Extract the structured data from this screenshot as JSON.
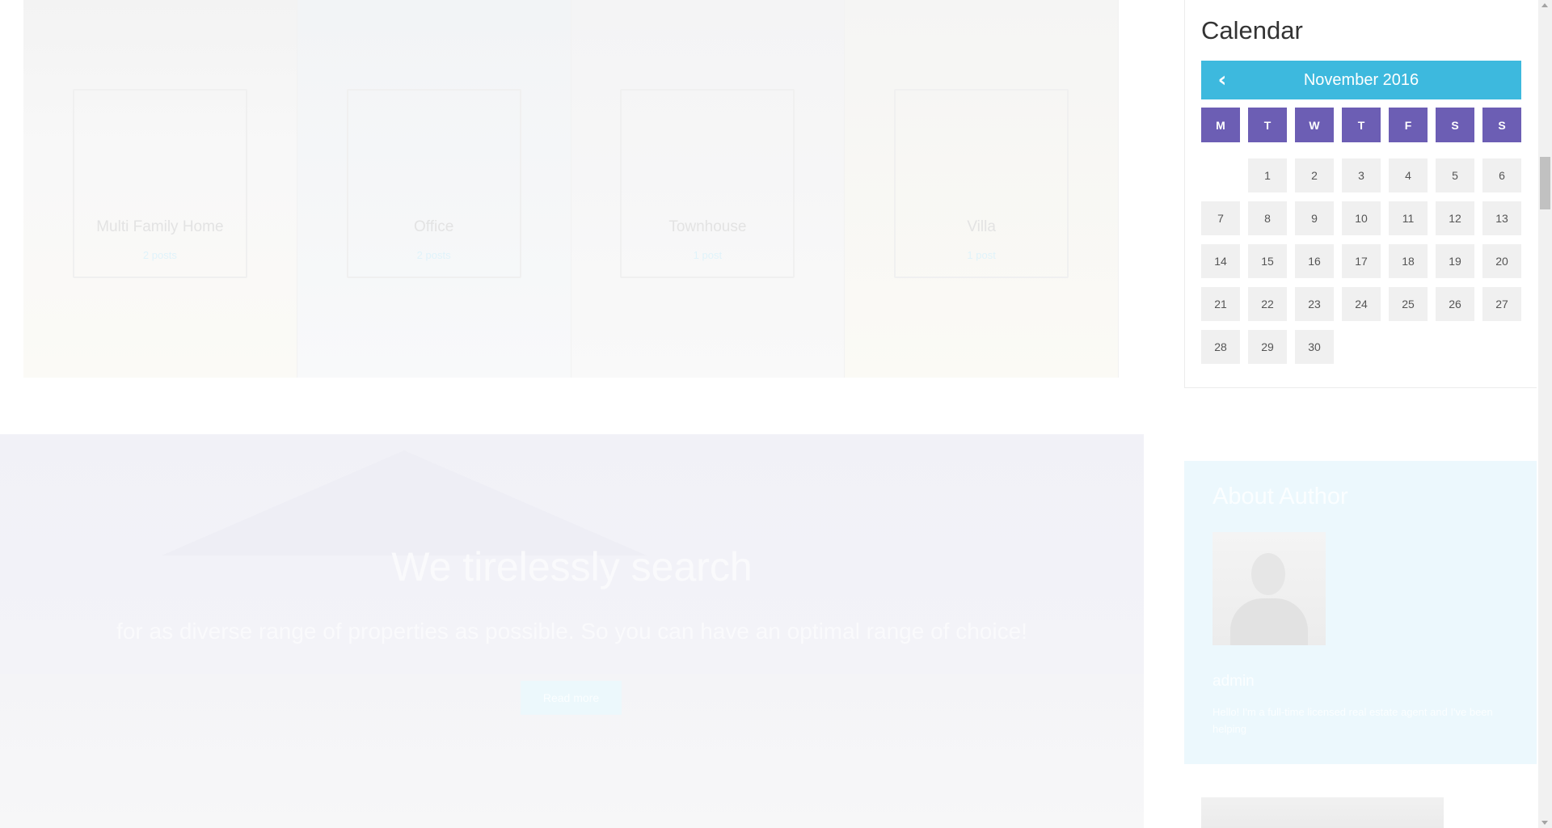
{
  "property_types": [
    {
      "name": "Multi Family Home",
      "count": "2 posts"
    },
    {
      "name": "Office",
      "count": "2 posts"
    },
    {
      "name": "Townhouse",
      "count": "1 post"
    },
    {
      "name": "Villa",
      "count": "1 post"
    }
  ],
  "hero": {
    "title": "We tirelessly search",
    "subtitle": "for as diverse range of properties as possible. So you can have an optimal range of choice!",
    "button_label": "Read more"
  },
  "calendar": {
    "heading": "Calendar",
    "prev_icon": "chevron-left-icon",
    "prev_glyph": "‹",
    "month": "November 2016",
    "weekdays": [
      "M",
      "T",
      "W",
      "T",
      "F",
      "S",
      "S"
    ],
    "first_day_offset": 1,
    "days": [
      "1",
      "2",
      "3",
      "4",
      "5",
      "6",
      "7",
      "8",
      "9",
      "10",
      "11",
      "12",
      "13",
      "14",
      "15",
      "16",
      "17",
      "18",
      "19",
      "20",
      "21",
      "22",
      "23",
      "24",
      "25",
      "26",
      "27",
      "28",
      "29",
      "30"
    ],
    "nav_color": "#3db9de",
    "weekday_color": "#6c5eb4"
  },
  "author": {
    "heading": "About Author",
    "name": "admin",
    "bio": "Hello! I'm a full-time licensed real estate agent and I've been helping"
  }
}
